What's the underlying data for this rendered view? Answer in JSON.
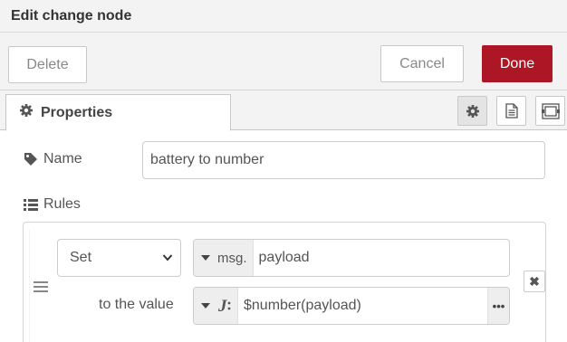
{
  "dialog": {
    "title": "Edit change node"
  },
  "toolbar": {
    "delete_label": "Delete",
    "cancel_label": "Cancel",
    "done_label": "Done",
    "done_color": "#ad1625"
  },
  "tabs": {
    "properties_label": "Properties",
    "icons": [
      "gear-icon",
      "document-icon",
      "node-appearance-icon"
    ]
  },
  "properties": {
    "name_label": "Name",
    "name_value": "battery to number",
    "rules_label": "Rules",
    "rules": [
      {
        "action": "Set",
        "target_type": "msg.",
        "target_value": "payload",
        "to_label": "to the value",
        "value_type_icon": "jsonata-icon",
        "value": "$number(payload)",
        "expand_label": "•••",
        "remove_label": "✖"
      }
    ]
  }
}
